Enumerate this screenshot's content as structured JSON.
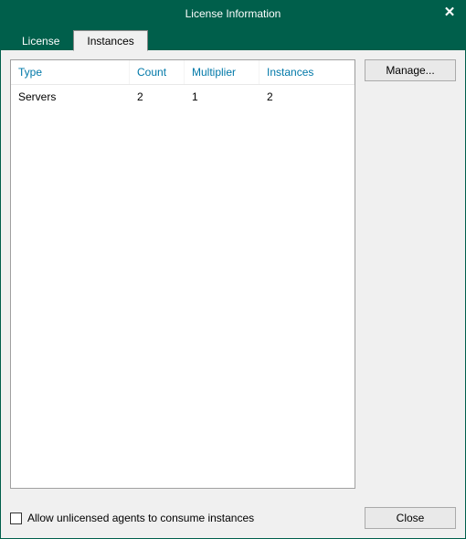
{
  "window": {
    "title": "License Information",
    "close_icon": "✕"
  },
  "tabs": [
    {
      "label": "License",
      "active": false
    },
    {
      "label": "Instances",
      "active": true
    }
  ],
  "table": {
    "headers": {
      "type": "Type",
      "count": "Count",
      "multiplier": "Multiplier",
      "instances": "Instances"
    },
    "rows": [
      {
        "type": "Servers",
        "count": "2",
        "multiplier": "1",
        "instances": "2"
      }
    ]
  },
  "buttons": {
    "manage": "Manage...",
    "close": "Close"
  },
  "footer": {
    "checkbox_label": "Allow unlicensed agents to consume instances",
    "checkbox_checked": false
  }
}
